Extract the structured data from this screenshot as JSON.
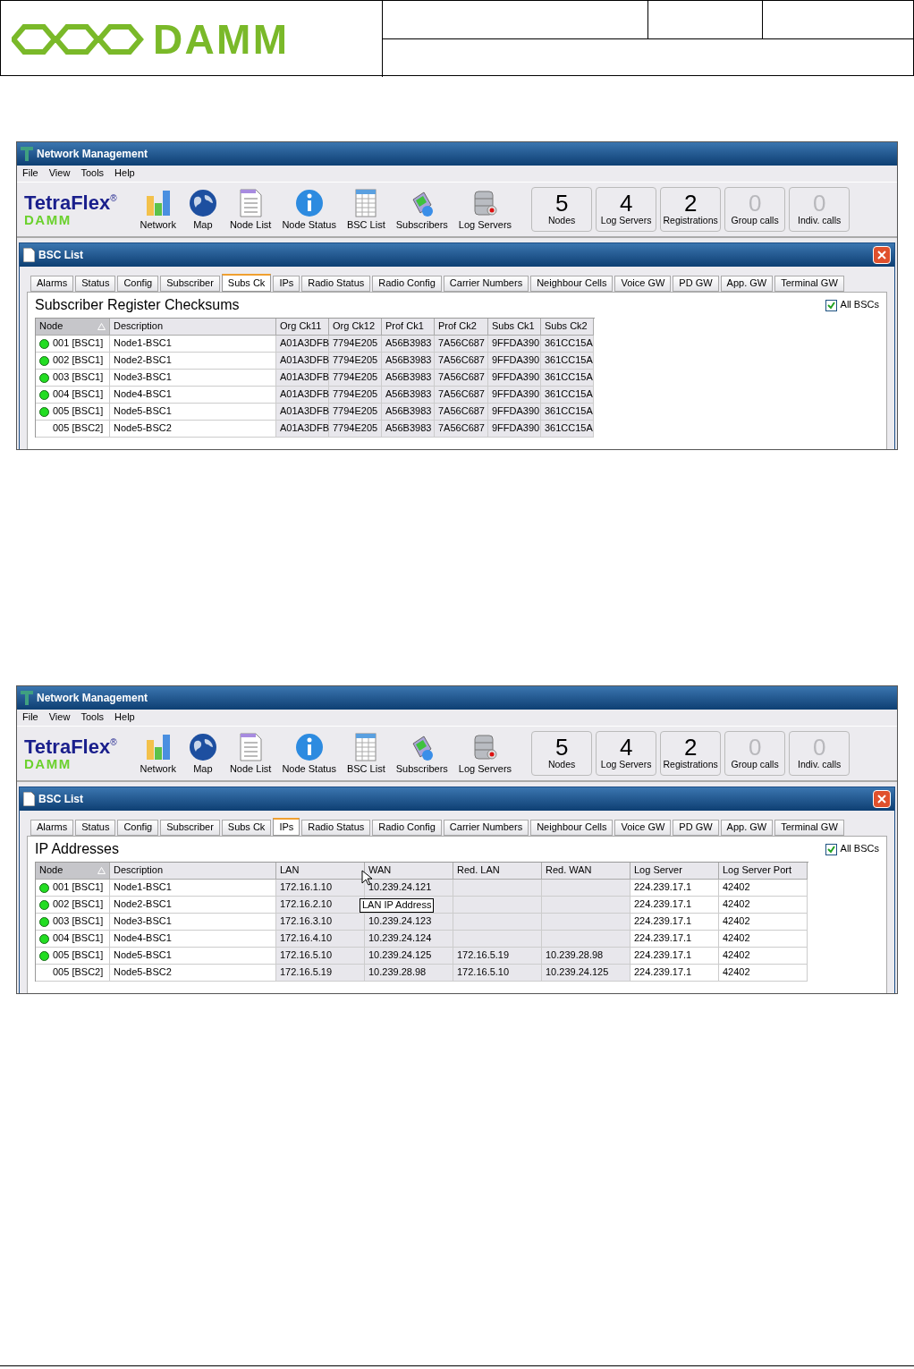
{
  "document_header": {
    "logo": "DAMM"
  },
  "screenshots": [
    {
      "window_title": "Network Management",
      "menu": [
        "File",
        "View",
        "Tools",
        "Help"
      ],
      "brand": {
        "name": "TetraFlex",
        "mark": "®",
        "sub": "DAMM"
      },
      "toolbar": [
        "Network",
        "Map",
        "Node List",
        "Node Status",
        "BSC List",
        "Subscribers",
        "Log Servers"
      ],
      "counters": [
        {
          "value": "5",
          "label": "Nodes",
          "dimmed": false
        },
        {
          "value": "4",
          "label": "Log Servers",
          "dimmed": false
        },
        {
          "value": "2",
          "label": "Registrations",
          "dimmed": false
        },
        {
          "value": "0",
          "label": "Group calls",
          "dimmed": true
        },
        {
          "value": "0",
          "label": "Indiv. calls",
          "dimmed": true
        }
      ],
      "panel_title": "BSC List",
      "tabs": [
        {
          "label": "Alarms",
          "selected": false
        },
        {
          "label": "Status",
          "selected": false
        },
        {
          "label": "Config",
          "selected": false
        },
        {
          "label": "Subscriber",
          "selected": false
        },
        {
          "label": "Subs Ck",
          "selected": true
        },
        {
          "label": "IPs",
          "selected": false
        },
        {
          "label": "Radio Status",
          "selected": false
        },
        {
          "label": "Radio Config",
          "selected": false
        },
        {
          "label": "Carrier Numbers",
          "selected": false
        },
        {
          "label": "Neighbour Cells",
          "selected": false
        },
        {
          "label": "Voice GW",
          "selected": false
        },
        {
          "label": "PD GW",
          "selected": false
        },
        {
          "label": "App. GW",
          "selected": false
        },
        {
          "label": "Terminal GW",
          "selected": false
        }
      ],
      "section_title": "Subscriber Register Checksums",
      "all_bscs": {
        "label": "All BSCs",
        "checked": true
      },
      "columns": [
        {
          "label": "Node",
          "sorted": true,
          "shaded": false
        },
        {
          "label": "Description",
          "sorted": false,
          "shaded": false
        },
        {
          "label": "Org Ck11",
          "sorted": false,
          "shaded": true
        },
        {
          "label": "Org Ck12",
          "sorted": false,
          "shaded": true
        },
        {
          "label": "Prof Ck1",
          "sorted": false,
          "shaded": true
        },
        {
          "label": "Prof Ck2",
          "sorted": false,
          "shaded": true
        },
        {
          "label": "Subs Ck1",
          "sorted": false,
          "shaded": true
        },
        {
          "label": "Subs Ck2",
          "sorted": false,
          "shaded": true
        }
      ],
      "rows": [
        {
          "online": true,
          "cells": [
            "001 [BSC1]",
            "Node1-BSC1",
            "A01A3DFB",
            "7794E205",
            "A56B3983",
            "7A56C687",
            "9FFDA390",
            "361CC15A"
          ]
        },
        {
          "online": true,
          "cells": [
            "002 [BSC1]",
            "Node2-BSC1",
            "A01A3DFB",
            "7794E205",
            "A56B3983",
            "7A56C687",
            "9FFDA390",
            "361CC15A"
          ]
        },
        {
          "online": true,
          "cells": [
            "003 [BSC1]",
            "Node3-BSC1",
            "A01A3DFB",
            "7794E205",
            "A56B3983",
            "7A56C687",
            "9FFDA390",
            "361CC15A"
          ]
        },
        {
          "online": true,
          "cells": [
            "004 [BSC1]",
            "Node4-BSC1",
            "A01A3DFB",
            "7794E205",
            "A56B3983",
            "7A56C687",
            "9FFDA390",
            "361CC15A"
          ]
        },
        {
          "online": true,
          "cells": [
            "005 [BSC1]",
            "Node5-BSC1",
            "A01A3DFB",
            "7794E205",
            "A56B3983",
            "7A56C687",
            "9FFDA390",
            "361CC15A"
          ]
        },
        {
          "online": false,
          "cells": [
            "005 [BSC2]",
            "Node5-BSC2",
            "A01A3DFB",
            "7794E205",
            "A56B3983",
            "7A56C687",
            "9FFDA390",
            "361CC15A"
          ]
        }
      ]
    },
    {
      "window_title": "Network Management",
      "menu": [
        "File",
        "View",
        "Tools",
        "Help"
      ],
      "brand": {
        "name": "TetraFlex",
        "mark": "®",
        "sub": "DAMM"
      },
      "toolbar": [
        "Network",
        "Map",
        "Node List",
        "Node Status",
        "BSC List",
        "Subscribers",
        "Log Servers"
      ],
      "counters": [
        {
          "value": "5",
          "label": "Nodes",
          "dimmed": false
        },
        {
          "value": "4",
          "label": "Log Servers",
          "dimmed": false
        },
        {
          "value": "2",
          "label": "Registrations",
          "dimmed": false
        },
        {
          "value": "0",
          "label": "Group calls",
          "dimmed": true
        },
        {
          "value": "0",
          "label": "Indiv. calls",
          "dimmed": true
        }
      ],
      "panel_title": "BSC List",
      "tabs": [
        {
          "label": "Alarms",
          "selected": false
        },
        {
          "label": "Status",
          "selected": false
        },
        {
          "label": "Config",
          "selected": false
        },
        {
          "label": "Subscriber",
          "selected": false
        },
        {
          "label": "Subs Ck",
          "selected": false
        },
        {
          "label": "IPs",
          "selected": true
        },
        {
          "label": "Radio Status",
          "selected": false
        },
        {
          "label": "Radio Config",
          "selected": false
        },
        {
          "label": "Carrier Numbers",
          "selected": false
        },
        {
          "label": "Neighbour Cells",
          "selected": false
        },
        {
          "label": "Voice GW",
          "selected": false
        },
        {
          "label": "PD GW",
          "selected": false
        },
        {
          "label": "App. GW",
          "selected": false
        },
        {
          "label": "Terminal GW",
          "selected": false
        }
      ],
      "section_title": "IP Addresses",
      "all_bscs": {
        "label": "All BSCs",
        "checked": true
      },
      "columns": [
        {
          "label": "Node",
          "sorted": true,
          "shaded": false
        },
        {
          "label": "Description",
          "sorted": false,
          "shaded": false
        },
        {
          "label": "LAN",
          "sorted": false,
          "shaded": true
        },
        {
          "label": "WAN",
          "sorted": false,
          "shaded": true
        },
        {
          "label": "Red. LAN",
          "sorted": false,
          "shaded": true
        },
        {
          "label": "Red. WAN",
          "sorted": false,
          "shaded": true
        },
        {
          "label": "Log Server",
          "sorted": false,
          "shaded": false
        },
        {
          "label": "Log Server Port",
          "sorted": false,
          "shaded": false
        }
      ],
      "rows": [
        {
          "online": true,
          "cells": [
            "001 [BSC1]",
            "Node1-BSC1",
            "172.16.1.10",
            "10.239.24.121",
            null,
            null,
            "224.239.17.1",
            "42402"
          ]
        },
        {
          "online": true,
          "cells": [
            "002 [BSC1]",
            "Node2-BSC1",
            "172.16.2.10",
            null,
            null,
            null,
            "224.239.17.1",
            "42402"
          ]
        },
        {
          "online": true,
          "cells": [
            "003 [BSC1]",
            "Node3-BSC1",
            "172.16.3.10",
            "10.239.24.123",
            null,
            null,
            "224.239.17.1",
            "42402"
          ]
        },
        {
          "online": true,
          "cells": [
            "004 [BSC1]",
            "Node4-BSC1",
            "172.16.4.10",
            "10.239.24.124",
            null,
            null,
            "224.239.17.1",
            "42402"
          ]
        },
        {
          "online": true,
          "cells": [
            "005 [BSC1]",
            "Node5-BSC1",
            "172.16.5.10",
            "10.239.24.125",
            "172.16.5.19",
            "10.239.28.98",
            "224.239.17.1",
            "42402"
          ]
        },
        {
          "online": false,
          "cells": [
            "005 [BSC2]",
            "Node5-BSC2",
            "172.16.5.19",
            "10.239.28.98",
            "172.16.5.10",
            "10.239.24.125",
            "224.239.17.1",
            "42402"
          ]
        }
      ],
      "tooltip": "LAN IP Address"
    }
  ]
}
